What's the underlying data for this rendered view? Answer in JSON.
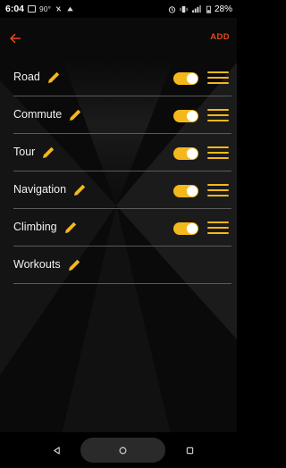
{
  "status_bar": {
    "time": "6:04",
    "temperature": "90°",
    "battery_percent": "28%"
  },
  "app_bar": {
    "add_label": "ADD",
    "accent_color": "#e64a19"
  },
  "accent_color": "#f4b81c",
  "categories": [
    {
      "name": "Road",
      "enabled": true
    },
    {
      "name": "Commute",
      "enabled": true
    },
    {
      "name": "Tour",
      "enabled": true
    },
    {
      "name": "Navigation",
      "enabled": true
    },
    {
      "name": "Climbing",
      "enabled": true
    },
    {
      "name": "Workouts"
    }
  ],
  "icons": {
    "back": "arrow-left-icon",
    "edit": "pencil-icon",
    "reorder": "drag-handle-icon",
    "nav_back": "triangle-back-icon",
    "nav_home": "circle-home-icon",
    "nav_recents": "square-recents-icon"
  }
}
